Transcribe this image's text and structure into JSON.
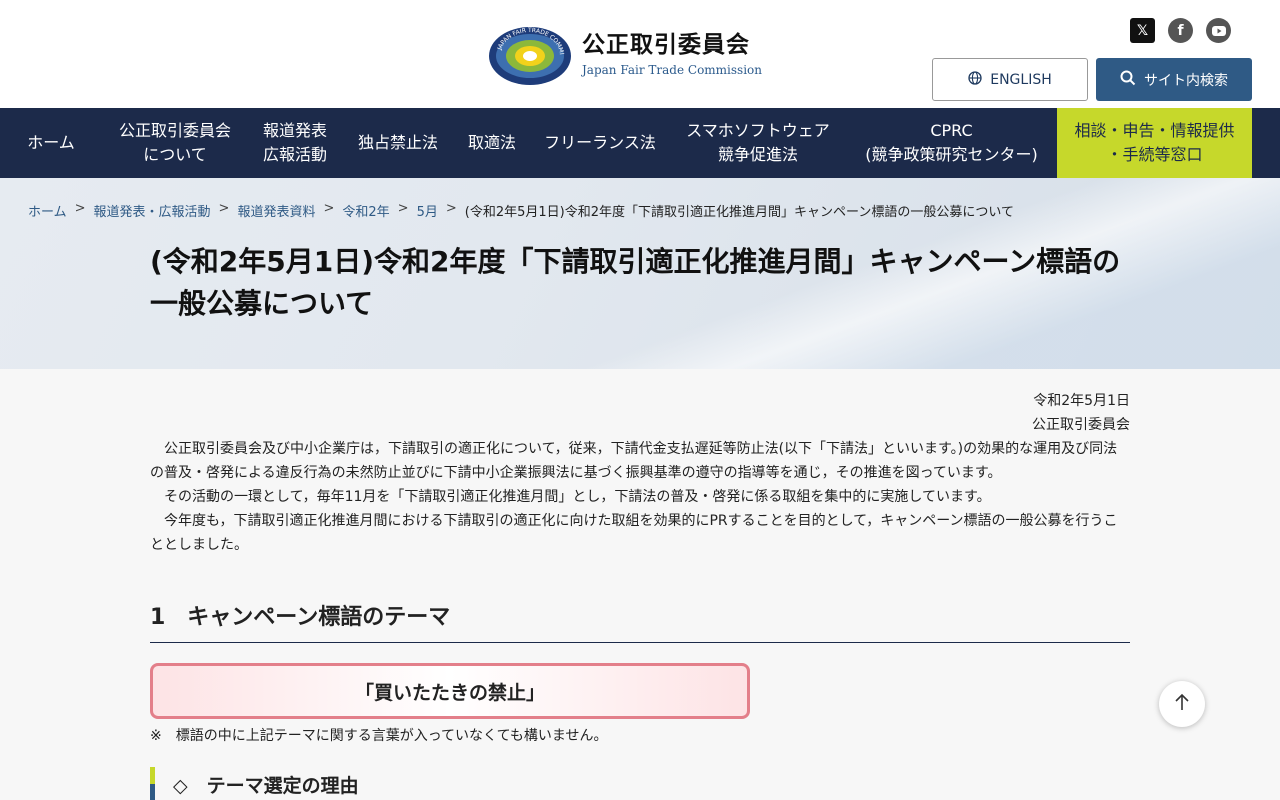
{
  "header": {
    "org_name_ja": "公正取引委員会",
    "org_name_en": "Japan Fair Trade Commission",
    "logo_ring_text": "JAPAN FAIR TRADE COMMISSION",
    "english_label": "ENGLISH",
    "search_label": "サイト内検索",
    "social": [
      "x-icon",
      "facebook-icon",
      "youtube-icon"
    ]
  },
  "nav": {
    "items": [
      {
        "label": "ホーム"
      },
      {
        "label": "公正取引委員会\nについて"
      },
      {
        "label": "報道発表\n広報活動"
      },
      {
        "label": "独占禁止法"
      },
      {
        "label": "取適法"
      },
      {
        "label": "フリーランス法"
      },
      {
        "label": "スマホソフトウェア\n競争促進法"
      },
      {
        "label": "CPRC\n(競争政策研究センター)"
      },
      {
        "label": "相談・申告・情報提供\n・手続等窓口"
      }
    ]
  },
  "breadcrumb": {
    "items": [
      "ホーム",
      "報道発表・広報活動",
      "報道発表資料",
      "令和2年",
      "5月"
    ],
    "current": "(令和2年5月1日)令和2年度「下請取引適正化推進月間」キャンペーン標語の一般公募について",
    "separator": ">"
  },
  "page": {
    "title": "(令和2年5月1日)令和2年度「下請取引適正化推進月間」キャンペーン標語の一般公募について",
    "date": "令和2年5月1日",
    "issuer": "公正取引委員会",
    "paragraphs": [
      "公正取引委員会及び中小企業庁は，下請取引の適正化について，従来，下請代金支払遅延等防止法(以下「下請法」といいます。)の効果的な運用及び同法の普及・啓発による違反行為の未然防止並びに下請中小企業振興法に基づく振興基準の遵守の指導等を通じ，その推進を図っています。",
      "その活動の一環として，毎年11月を「下請取引適正化推進月間」とし，下請法の普及・啓発に係る取組を集中的に実施しています。",
      "今年度も，下請取引適正化推進月間における下請取引の適正化に向けた取組を効果的にPRすることを目的として，キャンペーン標語の一般公募を行うこととしました。"
    ],
    "section1_heading": "1　キャンペーン標語のテーマ",
    "theme": "「買いたたきの禁止」",
    "note": "※　標語の中に上記テーマに関する言葉が入っていなくても構いません。",
    "subheading": "◇　テーマ選定の理由"
  },
  "colors": {
    "nav_bg": "#1c2a4a",
    "nav_highlight": "#c6d82b",
    "accent_blue": "#2f5a85",
    "theme_border": "#e37f8a"
  }
}
